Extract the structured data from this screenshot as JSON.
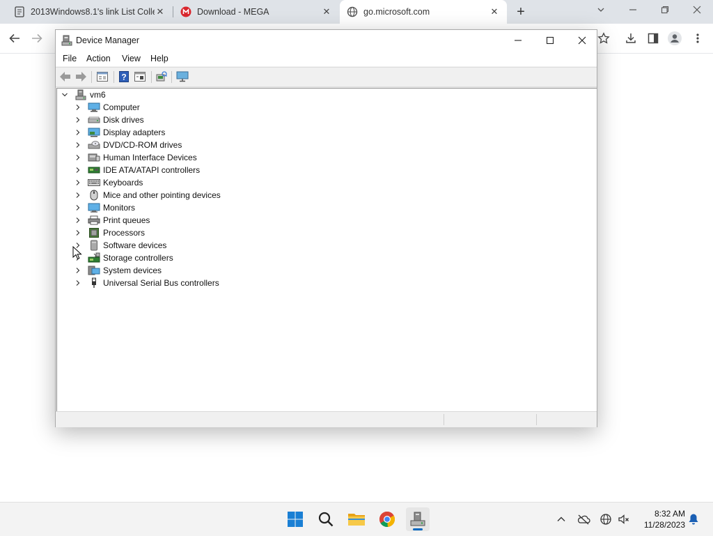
{
  "browser": {
    "tabs": [
      {
        "title": "2013Windows8.1's link List Collec",
        "favicon": "notebook-icon",
        "active": false
      },
      {
        "title": "Download - MEGA",
        "favicon": "mega-logo-icon",
        "active": false
      },
      {
        "title": "go.microsoft.com",
        "favicon": "globe-icon",
        "active": true
      }
    ],
    "new_tab_label": "+",
    "toolbar_icons": [
      "back-arrow-icon",
      "forward-arrow-icon",
      "star-icon",
      "download-icon",
      "side-panel-icon",
      "profile-icon",
      "more-vertical-icon"
    ]
  },
  "device_manager": {
    "title": "Device Manager",
    "menu": [
      "File",
      "Action",
      "View",
      "Help"
    ],
    "toolbar_icons": [
      "back-icon",
      "forward-icon",
      "properties-icon",
      "help-icon",
      "update-driver-view-icon",
      "scan-hardware-icon",
      "monitor-icon"
    ],
    "root": {
      "label": "vm6",
      "icon": "computer-tower-icon",
      "expanded": true
    },
    "categories": [
      {
        "label": "Computer",
        "icon": "computer-icon"
      },
      {
        "label": "Disk drives",
        "icon": "disk-drive-icon"
      },
      {
        "label": "Display adapters",
        "icon": "display-adapter-icon"
      },
      {
        "label": "DVD/CD-ROM drives",
        "icon": "dvd-drive-icon"
      },
      {
        "label": "Human Interface Devices",
        "icon": "hid-icon"
      },
      {
        "label": "IDE ATA/ATAPI controllers",
        "icon": "ide-controller-icon"
      },
      {
        "label": "Keyboards",
        "icon": "keyboard-icon"
      },
      {
        "label": "Mice and other pointing devices",
        "icon": "mouse-icon"
      },
      {
        "label": "Monitors",
        "icon": "monitor-icon"
      },
      {
        "label": "Print queues",
        "icon": "printer-icon"
      },
      {
        "label": "Processors",
        "icon": "processor-icon"
      },
      {
        "label": "Software devices",
        "icon": "software-device-icon"
      },
      {
        "label": "Storage controllers",
        "icon": "storage-controller-icon"
      },
      {
        "label": "System devices",
        "icon": "system-device-icon"
      },
      {
        "label": "Universal Serial Bus controllers",
        "icon": "usb-icon"
      }
    ]
  },
  "taskbar": {
    "apps": [
      "windows-start-icon",
      "search-icon",
      "file-explorer-icon",
      "chrome-icon",
      "device-manager-icon"
    ],
    "tray_icons": [
      "chevron-up-icon",
      "onedrive-offline-icon",
      "network-icon",
      "volume-muted-icon",
      "notification-bell-icon"
    ],
    "time": "8:32 AM",
    "date": "11/28/2023"
  },
  "colors": {
    "accent": "#0067c0",
    "tabstrip": "#dfe3e8",
    "mega_red": "#d9272e"
  }
}
